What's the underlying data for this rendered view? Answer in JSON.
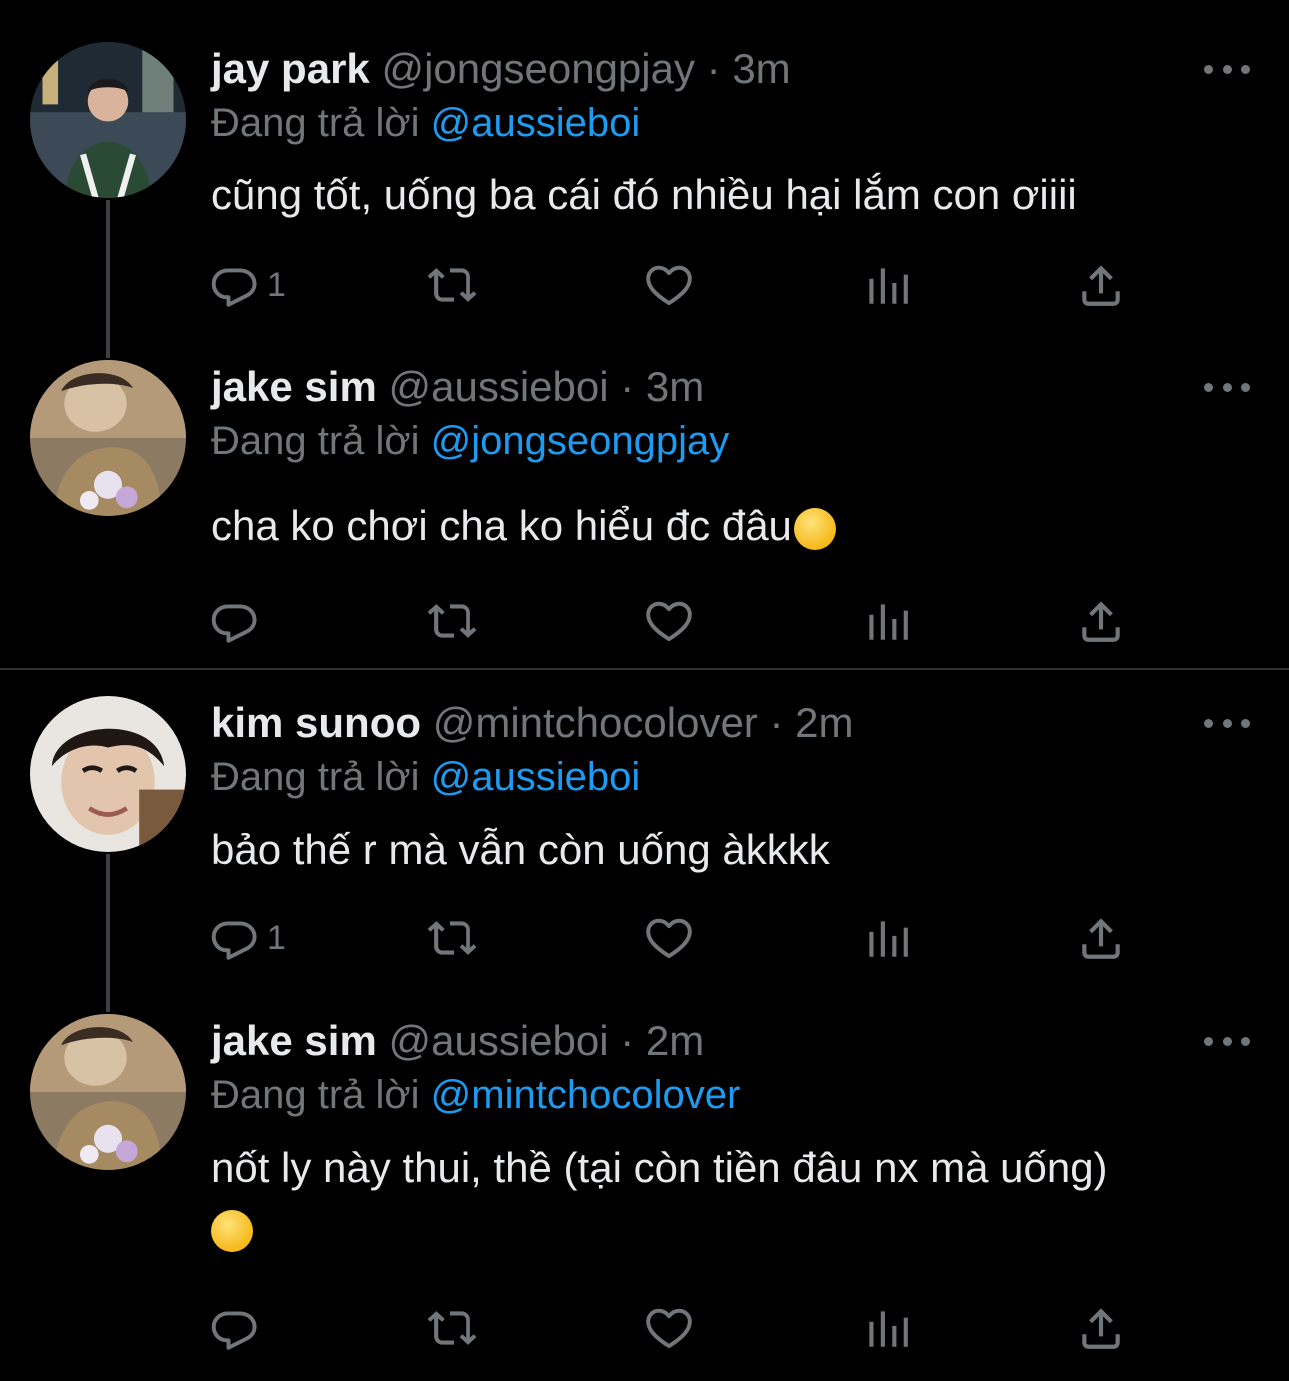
{
  "tweets": [
    {
      "name": "jay park",
      "handle": "@jongseongpjay",
      "dot": "·",
      "time": "3m",
      "replying_label": "Đang trả lời",
      "replying_to": "@aussieboi",
      "text": "cũng tốt, uống ba cái đó nhiều hại lắm con ơiiii",
      "reply_count": "1"
    },
    {
      "name": "jake sim",
      "handle": "@aussieboi",
      "dot": "·",
      "time": "3m",
      "replying_label": "Đang trả lời",
      "replying_to": "@jongseongpjay",
      "text": "cha ko chơi cha ko hiểu đc đâu",
      "emoji": "loudly-crying-face-emoji",
      "reply_count": ""
    },
    {
      "name": "kim sunoo",
      "handle": "@mintchocolover",
      "dot": "·",
      "time": "2m",
      "replying_label": "Đang trả lời",
      "replying_to": "@aussieboi",
      "text": "bảo thế r mà vẫn còn uống àkkkk",
      "reply_count": "1"
    },
    {
      "name": "jake sim",
      "handle": "@aussieboi",
      "dot": "·",
      "time": "2m",
      "replying_label": "Đang trả lời",
      "replying_to": "@mintchocolover",
      "text": "nốt ly này thui, thề (tại còn tiền đâu nx mà uống)",
      "emoji": "smiling-face-emoji",
      "reply_count": ""
    }
  ],
  "icons": [
    "reply-icon",
    "retweet-icon",
    "like-icon",
    "analytics-icon",
    "share-icon",
    "more-icon"
  ],
  "colors": {
    "background": "#000000",
    "text": "#e7e9ea",
    "muted": "#71767b",
    "accent": "#1d9bf0"
  }
}
